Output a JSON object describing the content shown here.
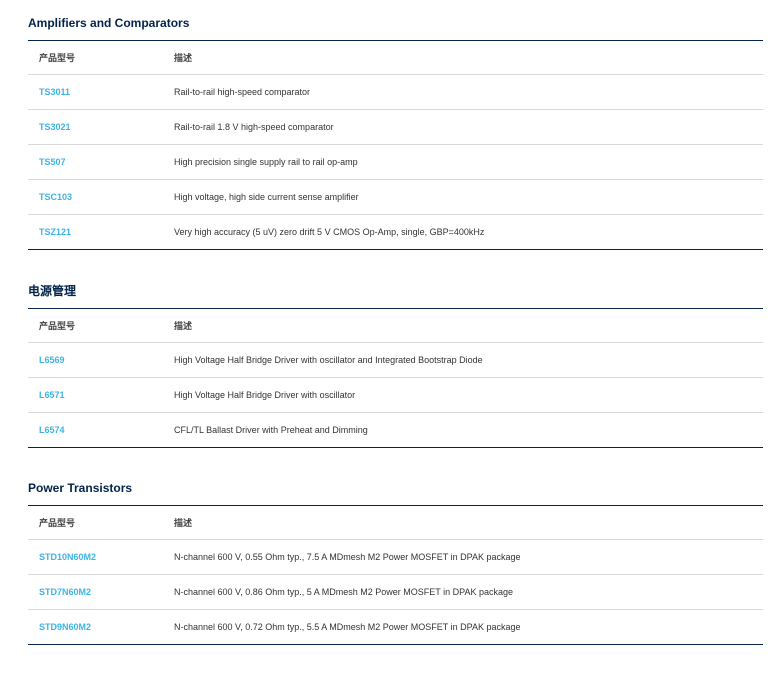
{
  "sections": [
    {
      "title": "Amplifiers and Comparators",
      "headers": {
        "part": "产品型号",
        "desc": "描述"
      },
      "rows": [
        {
          "part": "TS3011",
          "desc": "Rail-to-rail high-speed comparator"
        },
        {
          "part": "TS3021",
          "desc": "Rail-to-rail 1.8 V high-speed comparator"
        },
        {
          "part": "TS507",
          "desc": "High precision single supply rail to rail op-amp"
        },
        {
          "part": "TSC103",
          "desc": "High voltage, high side current sense amplifier"
        },
        {
          "part": "TSZ121",
          "desc": "Very high accuracy (5 uV) zero drift 5 V CMOS Op-Amp, single, GBP=400kHz"
        }
      ]
    },
    {
      "title": "电源管理",
      "headers": {
        "part": "产品型号",
        "desc": "描述"
      },
      "rows": [
        {
          "part": "L6569",
          "desc": "High Voltage Half Bridge Driver with oscillator and Integrated Bootstrap Diode"
        },
        {
          "part": "L6571",
          "desc": "High Voltage Half Bridge Driver with oscillator"
        },
        {
          "part": "L6574",
          "desc": "CFL/TL Ballast Driver with Preheat and Dimming"
        }
      ]
    },
    {
      "title": "Power Transistors",
      "headers": {
        "part": "产品型号",
        "desc": "描述"
      },
      "rows": [
        {
          "part": "STD10N60M2",
          "desc": "N-channel 600 V, 0.55 Ohm typ., 7.5 A MDmesh M2 Power MOSFET in DPAK package"
        },
        {
          "part": "STD7N60M2",
          "desc": "N-channel 600 V, 0.86 Ohm typ., 5 A MDmesh M2 Power MOSFET in DPAK package"
        },
        {
          "part": "STD9N60M2",
          "desc": "N-channel 600 V, 0.72 Ohm typ., 5.5 A MDmesh M2 Power MOSFET in DPAK package"
        }
      ]
    }
  ]
}
